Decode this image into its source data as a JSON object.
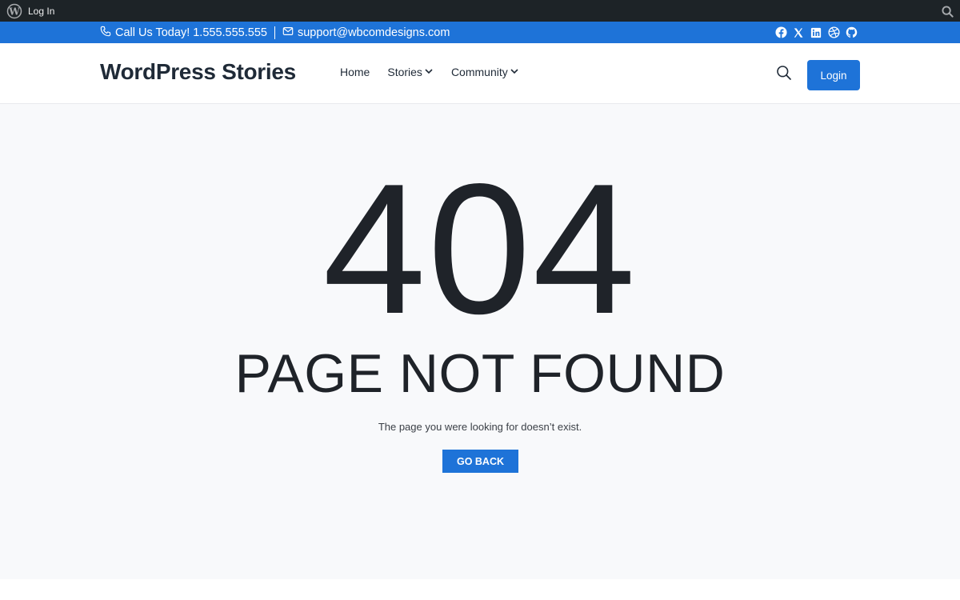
{
  "admin_bar": {
    "login_label": "Log In",
    "icons": [
      "wordpress-icon",
      "search-icon"
    ]
  },
  "topbar": {
    "phone_label": "Call Us Today! 1.555.555.555",
    "email_label": "support@wbcomdesigns.com",
    "social_icons": [
      "facebook-icon",
      "x-icon",
      "linkedin-icon",
      "dribbble-icon",
      "github-icon"
    ]
  },
  "header": {
    "site_title": "WordPress Stories",
    "nav": [
      {
        "label": "Home",
        "has_dropdown": false
      },
      {
        "label": "Stories",
        "has_dropdown": true
      },
      {
        "label": "Community",
        "has_dropdown": true
      }
    ],
    "login_label": "Login"
  },
  "main": {
    "error_code": "404",
    "heading": "PAGE NOT FOUND",
    "message": "The page you were looking for doesn’t exist.",
    "button_label": "GO BACK"
  },
  "colors": {
    "accent": "#1e73d8",
    "admin_bar": "#1d2327",
    "text_dark": "#1f2329",
    "page_bg": "#f8f9fb"
  }
}
